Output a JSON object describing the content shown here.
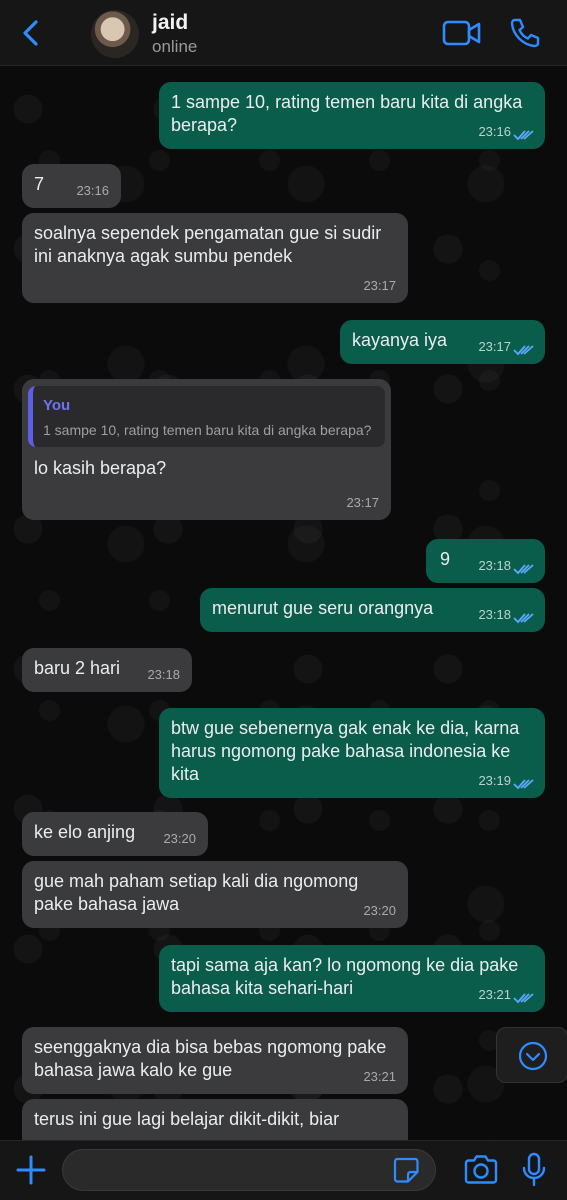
{
  "header": {
    "contact_name": "jaid",
    "contact_status": "online"
  },
  "messages": [
    {
      "dir": "out",
      "text": "1 sampe 10, rating temen baru kita di angka berapa?",
      "time": "23:16"
    },
    {
      "dir": "in",
      "text": "7",
      "time": "23:16"
    },
    {
      "dir": "in",
      "text": "soalnya sependek pengamatan gue si sudir ini anaknya agak sumbu pendek",
      "time": "23:17"
    },
    {
      "dir": "out",
      "text": "kayanya iya",
      "time": "23:17"
    },
    {
      "dir": "in",
      "quote_author": "You",
      "quote_text": "1 sampe 10, rating temen baru kita di angka berapa?",
      "text": "lo kasih berapa?",
      "time": "23:17"
    },
    {
      "dir": "out",
      "text": "9",
      "time": "23:18"
    },
    {
      "dir": "out",
      "text": "menurut gue seru orangnya",
      "time": "23:18"
    },
    {
      "dir": "in",
      "text": "baru 2 hari",
      "time": "23:18"
    },
    {
      "dir": "out",
      "text": "btw gue sebenernya gak enak ke dia, karna harus ngomong pake bahasa indonesia ke kita",
      "time": "23:19"
    },
    {
      "dir": "in",
      "text": "ke elo anjing",
      "time": "23:20"
    },
    {
      "dir": "in",
      "text": "gue mah paham setiap kali dia ngomong pake bahasa jawa",
      "time": "23:20"
    },
    {
      "dir": "out",
      "text": "tapi sama aja kan? lo ngomong ke dia pake bahasa kita sehari-hari",
      "time": "23:21"
    },
    {
      "dir": "in",
      "text": "seenggaknya dia bisa bebas ngomong pake bahasa jawa kalo ke gue",
      "time": "23:21"
    },
    {
      "dir": "in",
      "text": "terus ini gue lagi belajar dikit-dikit, biar",
      "time": ""
    }
  ],
  "colors": {
    "incoming_bubble": "#3b3b3d",
    "outgoing_bubble": "#0b5d4b",
    "accent": "#2f8cff",
    "read_ticks": "#5aa9ff",
    "quote_accent": "#5b61e6"
  },
  "icons": {
    "back": "chevron-left-icon",
    "video": "video-camera-icon",
    "call": "phone-icon",
    "scroll": "chevron-down-circle-icon",
    "plus": "plus-icon",
    "sticker": "sticker-icon",
    "camera": "camera-icon",
    "mic": "microphone-icon"
  },
  "composer": {
    "value": "",
    "placeholder": ""
  }
}
